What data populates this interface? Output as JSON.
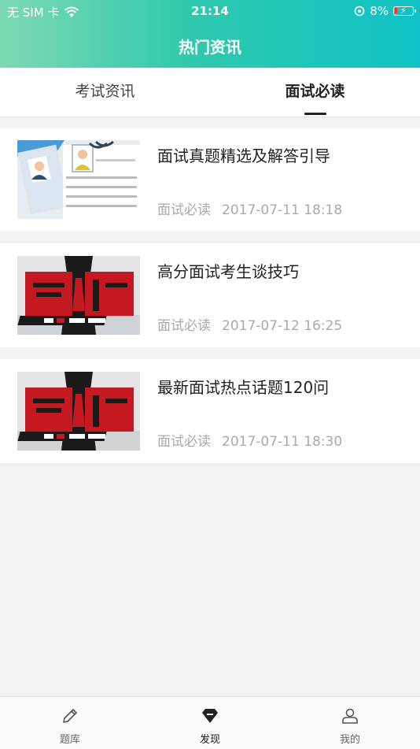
{
  "status_bar": {
    "carrier": "无 SIM 卡",
    "time": "21:14",
    "battery": "8%"
  },
  "header": {
    "title": "热门资讯"
  },
  "tabs": [
    {
      "label": "考试资讯",
      "active": false
    },
    {
      "label": "面试必读",
      "active": true
    }
  ],
  "articles": [
    {
      "title": "面试真题精选及解答引导",
      "category": "面试必读",
      "date": "2017-07-11 18:18",
      "thumb": "resume-icon"
    },
    {
      "title": "高分面试考生谈技巧",
      "category": "面试必读",
      "date": "2017-07-12 16:25",
      "thumb": "interview-poster"
    },
    {
      "title": "最新面试热点话题120问",
      "category": "面试必读",
      "date": "2017-07-11 18:30",
      "thumb": "interview-poster"
    }
  ],
  "tab_bar": [
    {
      "label": "题库",
      "icon": "pencil-icon",
      "active": false
    },
    {
      "label": "发现",
      "icon": "diamond-icon",
      "active": true
    },
    {
      "label": "我的",
      "icon": "user-icon",
      "active": false
    }
  ],
  "colors": {
    "header_start": "#7dd9b2",
    "header_end": "#10c2c6",
    "battery_low": "#ee3333"
  }
}
